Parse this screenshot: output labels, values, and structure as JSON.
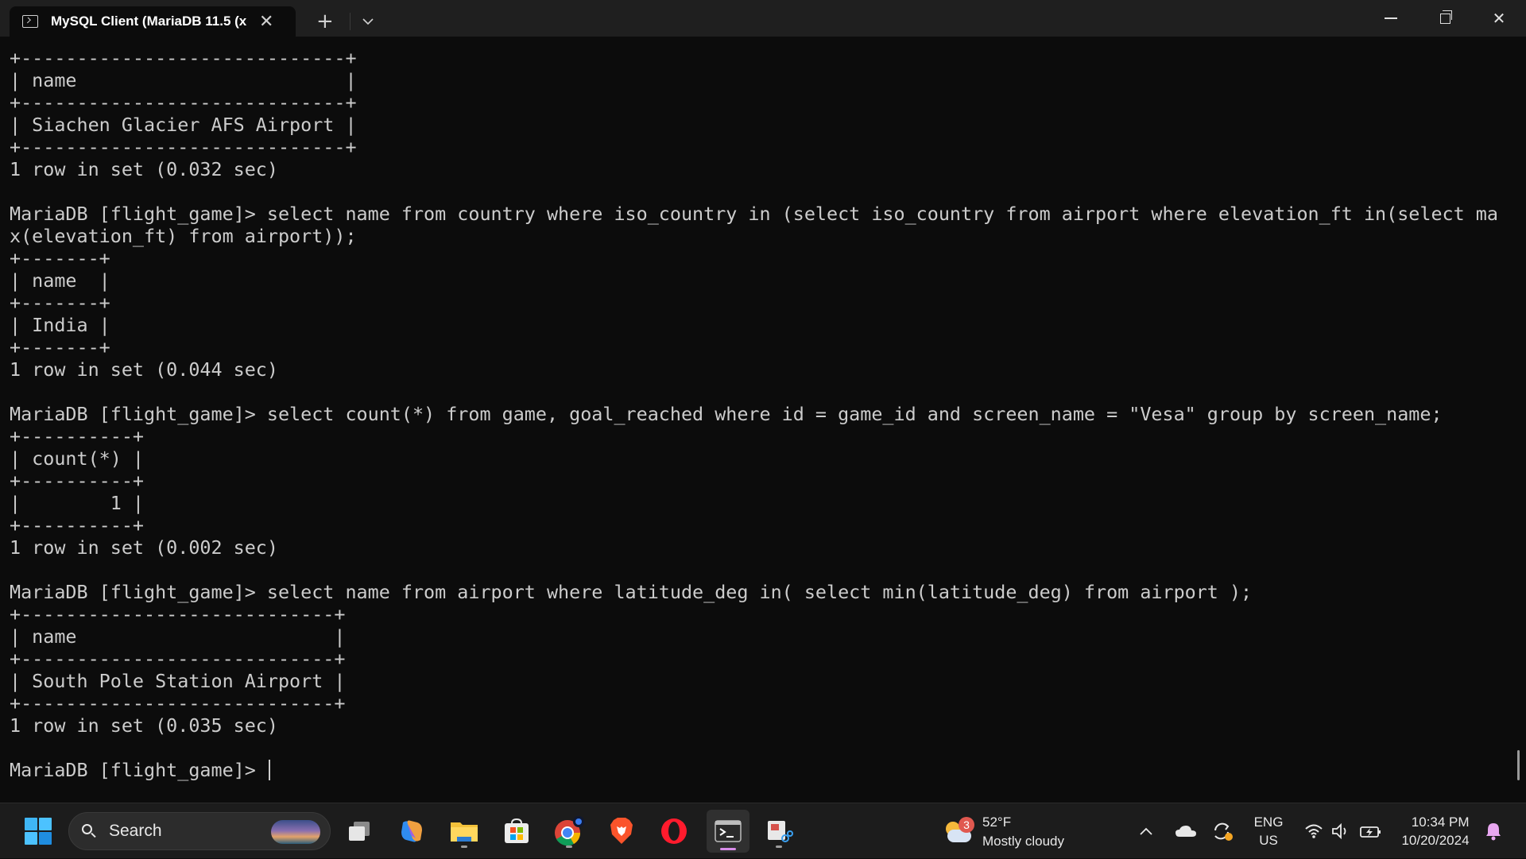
{
  "window": {
    "tab_title": "MySQL Client (MariaDB 11.5 (x",
    "tab_close": "✕",
    "new_tab": "+",
    "dropdown": "⌄",
    "close": "✕"
  },
  "terminal": {
    "lines": [
      "+-----------------------------+",
      "| name                        |",
      "+-----------------------------+",
      "| Siachen Glacier AFS Airport |",
      "+-----------------------------+",
      "1 row in set (0.032 sec)",
      "",
      "MariaDB [flight_game]> select name from country where iso_country in (select iso_country from airport where elevation_ft in(select ma",
      "x(elevation_ft) from airport));",
      "+-------+",
      "| name  |",
      "+-------+",
      "| India |",
      "+-------+",
      "1 row in set (0.044 sec)",
      "",
      "MariaDB [flight_game]> select count(*) from game, goal_reached where id = game_id and screen_name = \"Vesa\" group by screen_name;",
      "+----------+",
      "| count(*) |",
      "+----------+",
      "|        1 |",
      "+----------+",
      "1 row in set (0.002 sec)",
      "",
      "MariaDB [flight_game]> select name from airport where latitude_deg in( select min(latitude_deg) from airport );",
      "+----------------------------+",
      "| name                       |",
      "+----------------------------+",
      "| South Pole Station Airport |",
      "+----------------------------+",
      "1 row in set (0.035 sec)",
      ""
    ],
    "prompt": "MariaDB [flight_game]> "
  },
  "taskbar": {
    "search_label": "Search",
    "weather": {
      "badge": "3",
      "temperature": "52°F",
      "condition": "Mostly cloudy"
    },
    "tray": {
      "chevron": "⌃",
      "language_top": "ENG",
      "language_bottom": "US"
    },
    "clock": {
      "time": "10:34 PM",
      "date": "10/20/2024"
    }
  },
  "colors": {
    "terminal_bg": "#0c0c0c",
    "terminal_fg": "#cccccc",
    "titlebar_bg": "#1f1f1f",
    "taskbar_bg": "#1c1c1c",
    "active_indicator": "#d78ce8"
  }
}
